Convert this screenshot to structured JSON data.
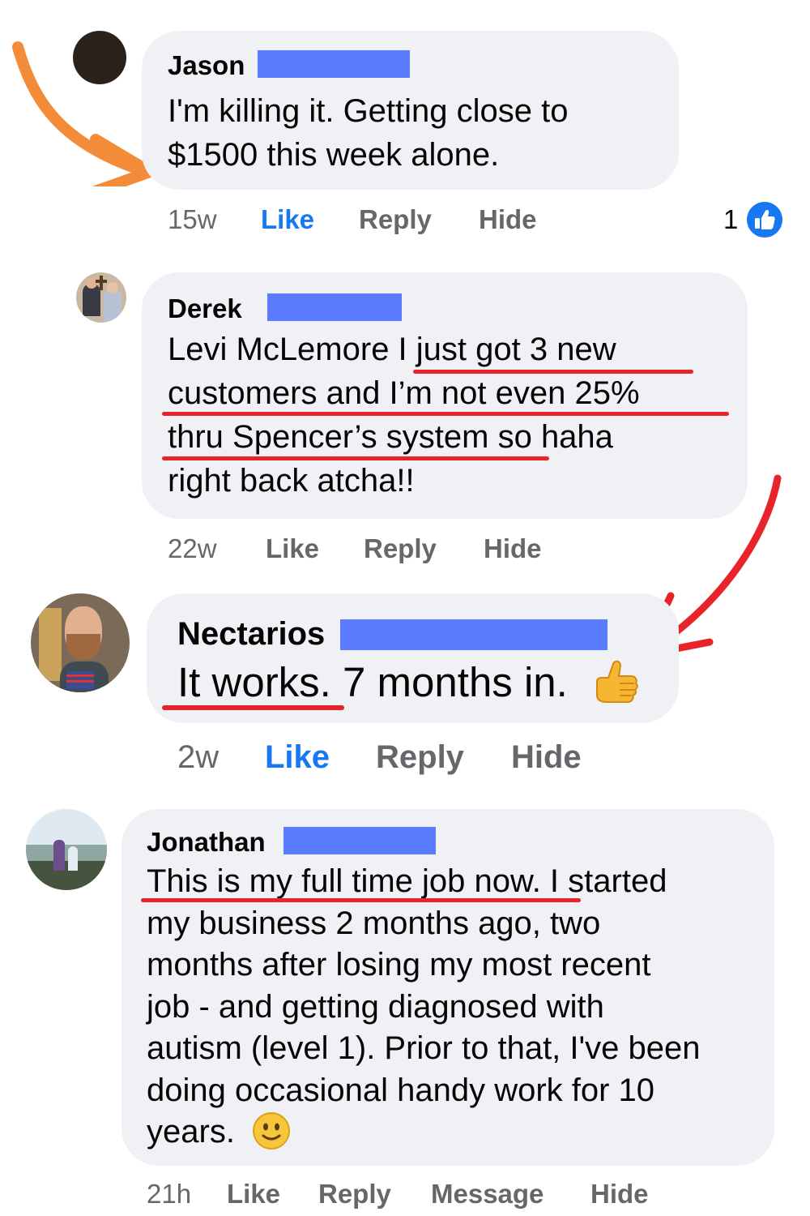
{
  "comments": [
    {
      "author": "Jason",
      "lines": [
        "I'm killing it.  Getting close to",
        "$1500 this week alone."
      ],
      "time": "15w",
      "like": "Like",
      "reply": "Reply",
      "hide": "Hide",
      "reaction_count": "1",
      "like_active": true
    },
    {
      "author": "Derek",
      "lines": [
        "Levi McLemore I just got 3 new",
        "customers and I’m not even 25%",
        "thru Spencer’s system so haha",
        "right back atcha!!"
      ],
      "time": "22w",
      "like": "Like",
      "reply": "Reply",
      "hide": "Hide",
      "like_active": false
    },
    {
      "author": "Nectarios",
      "lines": [
        "It works. 7 months in."
      ],
      "emoji": "thumbs-up",
      "time": "2w",
      "like": "Like",
      "reply": "Reply",
      "hide": "Hide",
      "like_active": true
    },
    {
      "author": "Jonathan",
      "lines": [
        "This is my full time job now. I started",
        "my business 2 months ago, two",
        "months after losing my most recent",
        "job - and getting diagnosed with",
        "autism (level 1). Prior to that, I've been",
        "doing occasional handy work for 10",
        "years."
      ],
      "emoji": "slightly-smiling-face",
      "time": "21h",
      "like": "Like",
      "reply": "Reply",
      "message": "Message",
      "hide": "Hide",
      "like_active": false
    }
  ],
  "colors": {
    "bubble": "#f0f1f5",
    "like_blue": "#1877f2",
    "muted": "#65676b",
    "redaction": "#5b7cff",
    "annotation_orange": "#f28c38",
    "annotation_red": "#e8232a"
  }
}
